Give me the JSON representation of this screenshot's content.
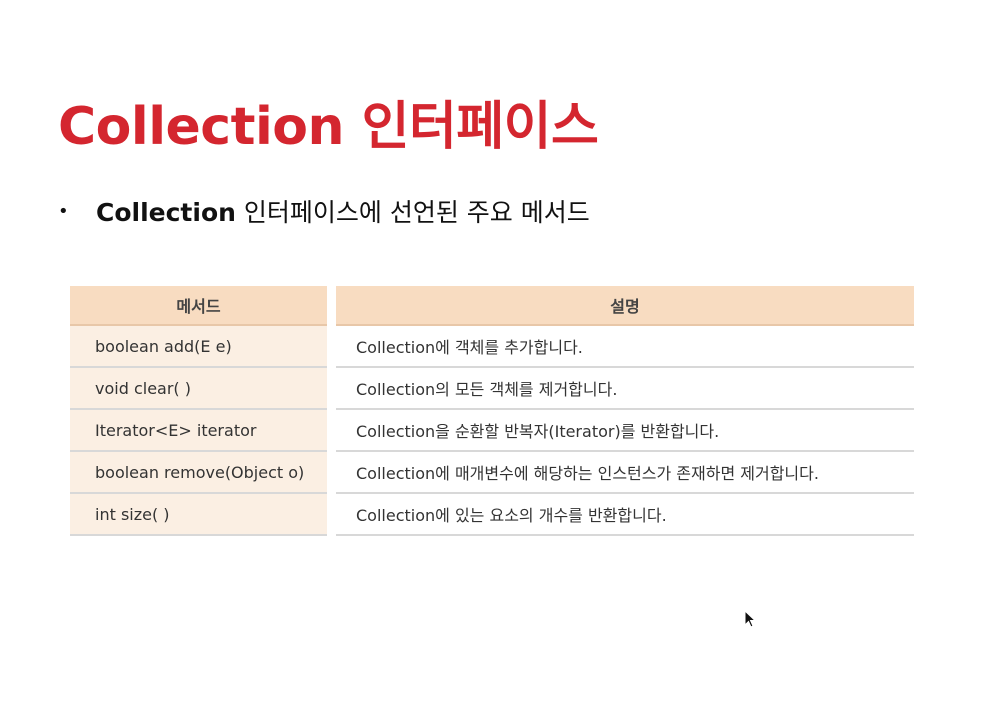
{
  "slide": {
    "title": "Collection 인터페이스",
    "bullet": {
      "marker": "•",
      "bold_text": "Collection",
      "rest_text": " 인터페이스에 선언된 주요 메서드"
    }
  },
  "table": {
    "headers": [
      "메서드",
      "설명"
    ],
    "rows": [
      {
        "method": "boolean add(E e)",
        "description": "Collection에 객체를 추가합니다."
      },
      {
        "method": "void clear( )",
        "description": "Collection의 모든 객체를 제거합니다."
      },
      {
        "method": "Iterator<E> iterator",
        "description": "Collection을 순환할 반복자(Iterator)를 반환합니다."
      },
      {
        "method": "boolean remove(Object o)",
        "description": "Collection에 매개변수에 해당하는 인스턴스가 존재하면 제거합니다."
      },
      {
        "method": "int size( )",
        "description": "Collection에 있는 요소의 개수를 반환합니다."
      }
    ]
  },
  "colors": {
    "title": "#d4262f",
    "header_bg": "#f8dcc1",
    "method_cell_bg": "#fbefe3"
  },
  "icons": {
    "cursor": "mouse-pointer-icon"
  }
}
